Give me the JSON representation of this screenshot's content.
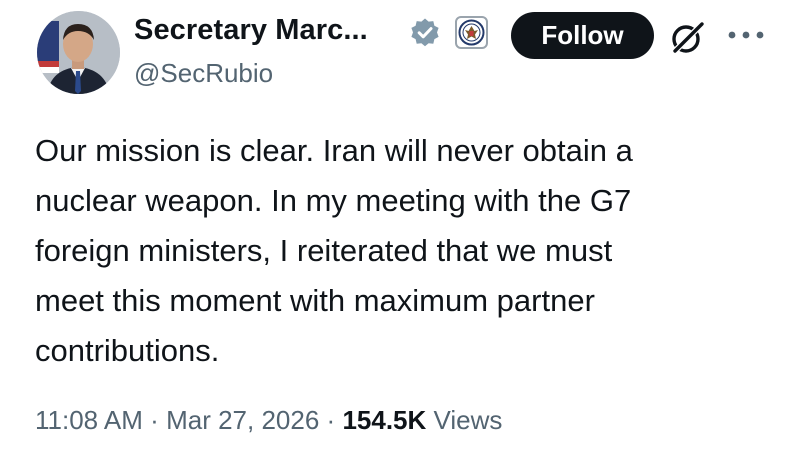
{
  "author": {
    "display_name": "Secretary Marc...",
    "handle": "@SecRubio",
    "verified_icon": "verified-badge-icon",
    "affiliation_icon": "state-department-seal-icon"
  },
  "actions": {
    "follow_label": "Follow",
    "grok_icon": "grok-icon",
    "more_icon": "more-options-icon"
  },
  "tweet": {
    "lines": [
      "Our mission is clear. Iran will never obtain a",
      "nuclear weapon. In my meeting with the G7",
      "foreign ministers, I reiterated that we must",
      "meet this moment with maximum partner",
      "contributions."
    ]
  },
  "meta": {
    "time": "11:08 AM",
    "separator": "·",
    "date": "Mar 27, 2026",
    "views_count": "154.5K",
    "views_label": "Views"
  },
  "colors": {
    "text_primary": "#0f1419",
    "text_secondary": "#536471",
    "verified": "#829aab",
    "follow_bg": "#0f1419"
  }
}
